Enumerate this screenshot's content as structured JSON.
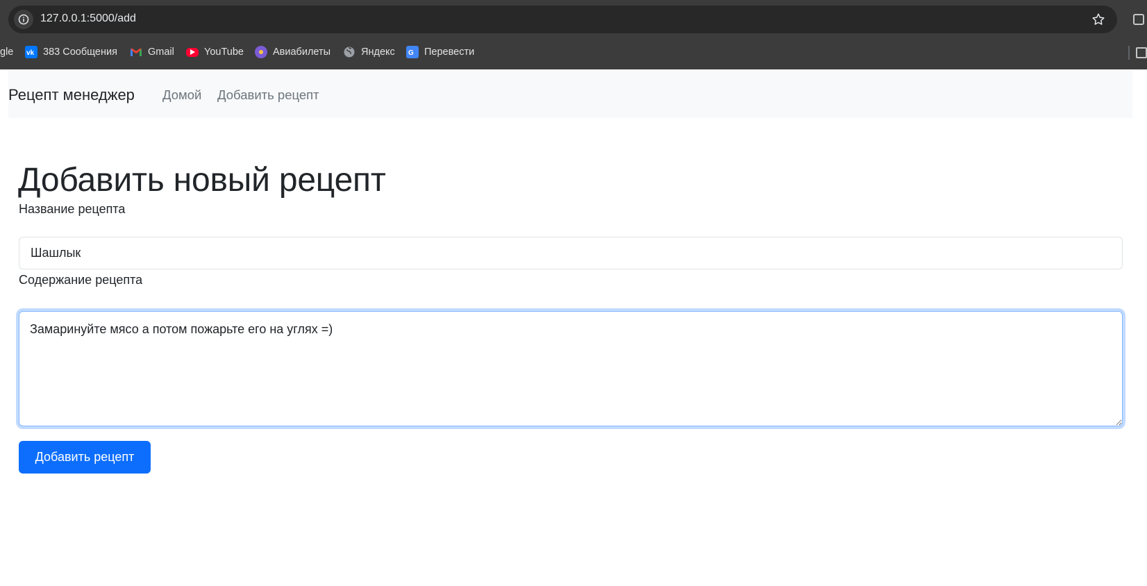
{
  "browser": {
    "url": "127.0.0.1:5000/add",
    "bookmarks": [
      {
        "label": "gle",
        "icon": "google-icon"
      },
      {
        "label": "383 Сообщения",
        "icon": "vk-icon"
      },
      {
        "label": "Gmail",
        "icon": "gmail-icon"
      },
      {
        "label": "YouTube",
        "icon": "youtube-icon"
      },
      {
        "label": "Авиабилеты",
        "icon": "aviasales-icon"
      },
      {
        "label": "Яндекс",
        "icon": "globe-icon"
      },
      {
        "label": "Перевести",
        "icon": "google-translate-icon"
      }
    ]
  },
  "navbar": {
    "brand": "Рецепт менеджер",
    "links": [
      {
        "label": "Домой"
      },
      {
        "label": "Добавить рецепт"
      }
    ]
  },
  "form": {
    "title": "Добавить новый рецепт",
    "name_label": "Название рецепта",
    "name_value": "Шашлык",
    "content_label": "Содержание рецепта",
    "content_value": "Замаринуйте мясо а потом пожарьте его на углях =)",
    "submit_label": "Добавить рецепт"
  },
  "colors": {
    "primary": "#0d6efd",
    "navbar_bg": "#f8f9fa",
    "chrome_bg": "#3c3c3c"
  }
}
